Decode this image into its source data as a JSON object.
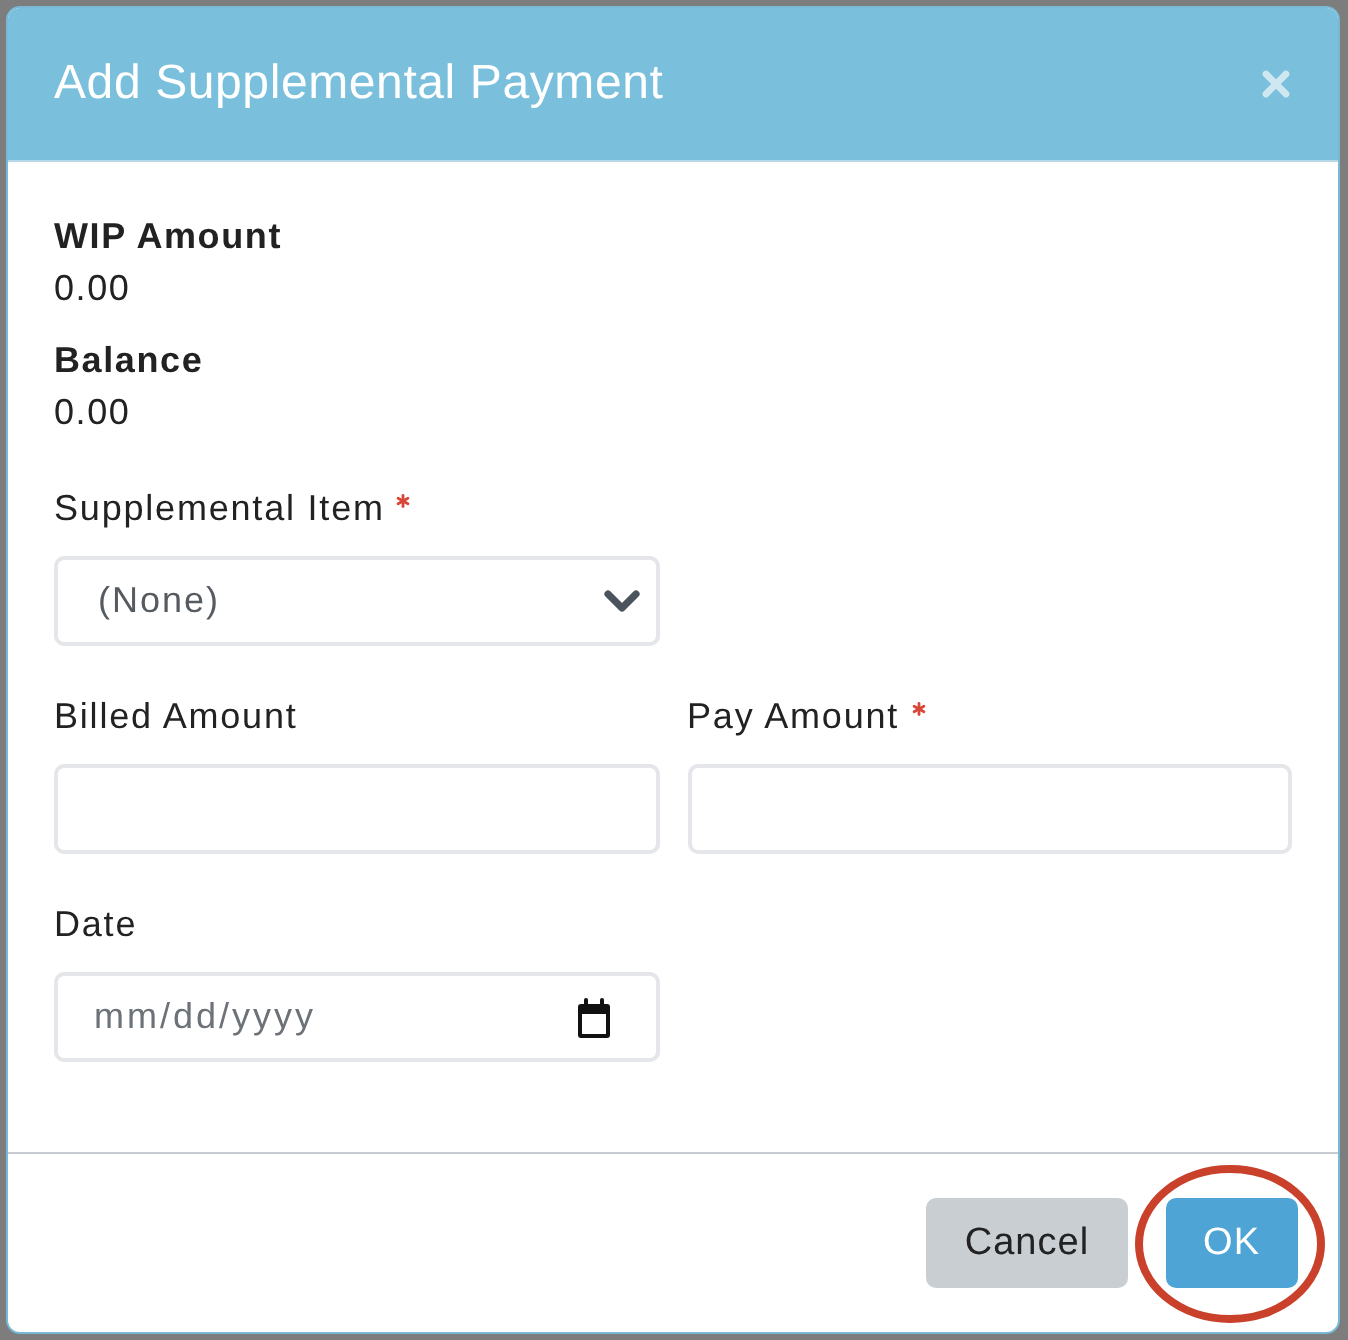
{
  "dialog": {
    "title": "Add Supplemental Payment"
  },
  "summary": [
    {
      "label": "WIP Amount",
      "value": "0.00"
    },
    {
      "label": "Balance",
      "value": "0.00"
    }
  ],
  "form_rows": [
    {
      "fields": [
        {
          "kind": "select",
          "label": "Supplemental Item",
          "required": true,
          "value": "(None)"
        }
      ]
    },
    {
      "fields": [
        {
          "kind": "text",
          "label": "Billed Amount",
          "required": false
        },
        {
          "kind": "text",
          "label": "Pay Amount",
          "required": true
        }
      ]
    },
    {
      "fields": [
        {
          "kind": "date",
          "label": "Date",
          "required": false,
          "placeholder": "mm/dd/yyyy"
        }
      ]
    }
  ],
  "buttons": [
    {
      "label": "Cancel",
      "kind": "secondary",
      "highlighted": false
    },
    {
      "label": "OK",
      "kind": "primary",
      "highlighted": true
    }
  ]
}
